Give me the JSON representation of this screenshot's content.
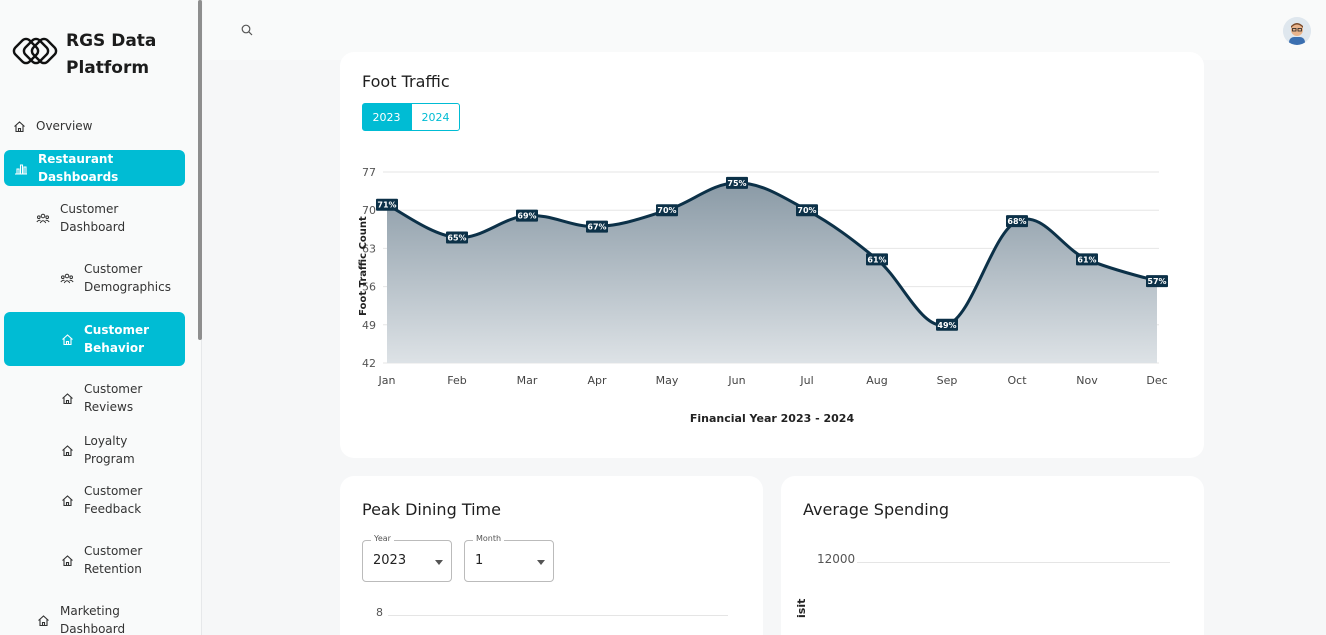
{
  "brand": {
    "name": "RGS Data Platform"
  },
  "sidebar": {
    "items": [
      {
        "label": "Overview",
        "icon": "home-icon"
      },
      {
        "label": "Restaurant Dashboards",
        "icon": "bar-chart-icon"
      },
      {
        "label": "Customer Dashboard",
        "icon": "users-icon"
      },
      {
        "label": "Customer Demographics",
        "icon": "users-icon"
      },
      {
        "label": "Customer Behavior",
        "icon": "home-icon"
      },
      {
        "label": "Customer Reviews",
        "icon": "home-icon"
      },
      {
        "label": "Loyalty Program",
        "icon": "home-icon"
      },
      {
        "label": "Customer Feedback",
        "icon": "home-icon"
      },
      {
        "label": "Customer Retention",
        "icon": "home-icon"
      },
      {
        "label": "Marketing Dashboard",
        "icon": "home-icon"
      }
    ],
    "accent": "#00bcd4"
  },
  "foot_traffic": {
    "title": "Foot Traffic",
    "tabs": [
      "2023",
      "2024"
    ],
    "selected_tab": "2023"
  },
  "peak_dining": {
    "title": "Peak Dining Time",
    "year_label": "Year",
    "year_value": "2023",
    "month_label": "Month",
    "month_value": "1",
    "y_top_tick": "8"
  },
  "average_spending": {
    "title": "Average Spending",
    "y_top_tick": "12000",
    "ylabel_partial": "isit"
  },
  "chart_data": {
    "type": "area",
    "categories": [
      "Jan",
      "Feb",
      "Mar",
      "Apr",
      "May",
      "Jun",
      "Jul",
      "Aug",
      "Sep",
      "Oct",
      "Nov",
      "Dec"
    ],
    "values": [
      71,
      65,
      69,
      67,
      70,
      75,
      70,
      61,
      49,
      68,
      61,
      57
    ],
    "data_labels": [
      "71%",
      "65%",
      "69%",
      "67%",
      "70%",
      "75%",
      "70%",
      "61%",
      "49%",
      "68%",
      "61%",
      "57%"
    ],
    "yticks": [
      "42",
      "49",
      "56",
      "63",
      "70",
      "77"
    ],
    "ylim": [
      42,
      77
    ],
    "xlabel": "Financial Year 2023 - 2024",
    "ylabel": "Foot Traffic Count",
    "grid": true,
    "line_color": "#0c3148"
  }
}
